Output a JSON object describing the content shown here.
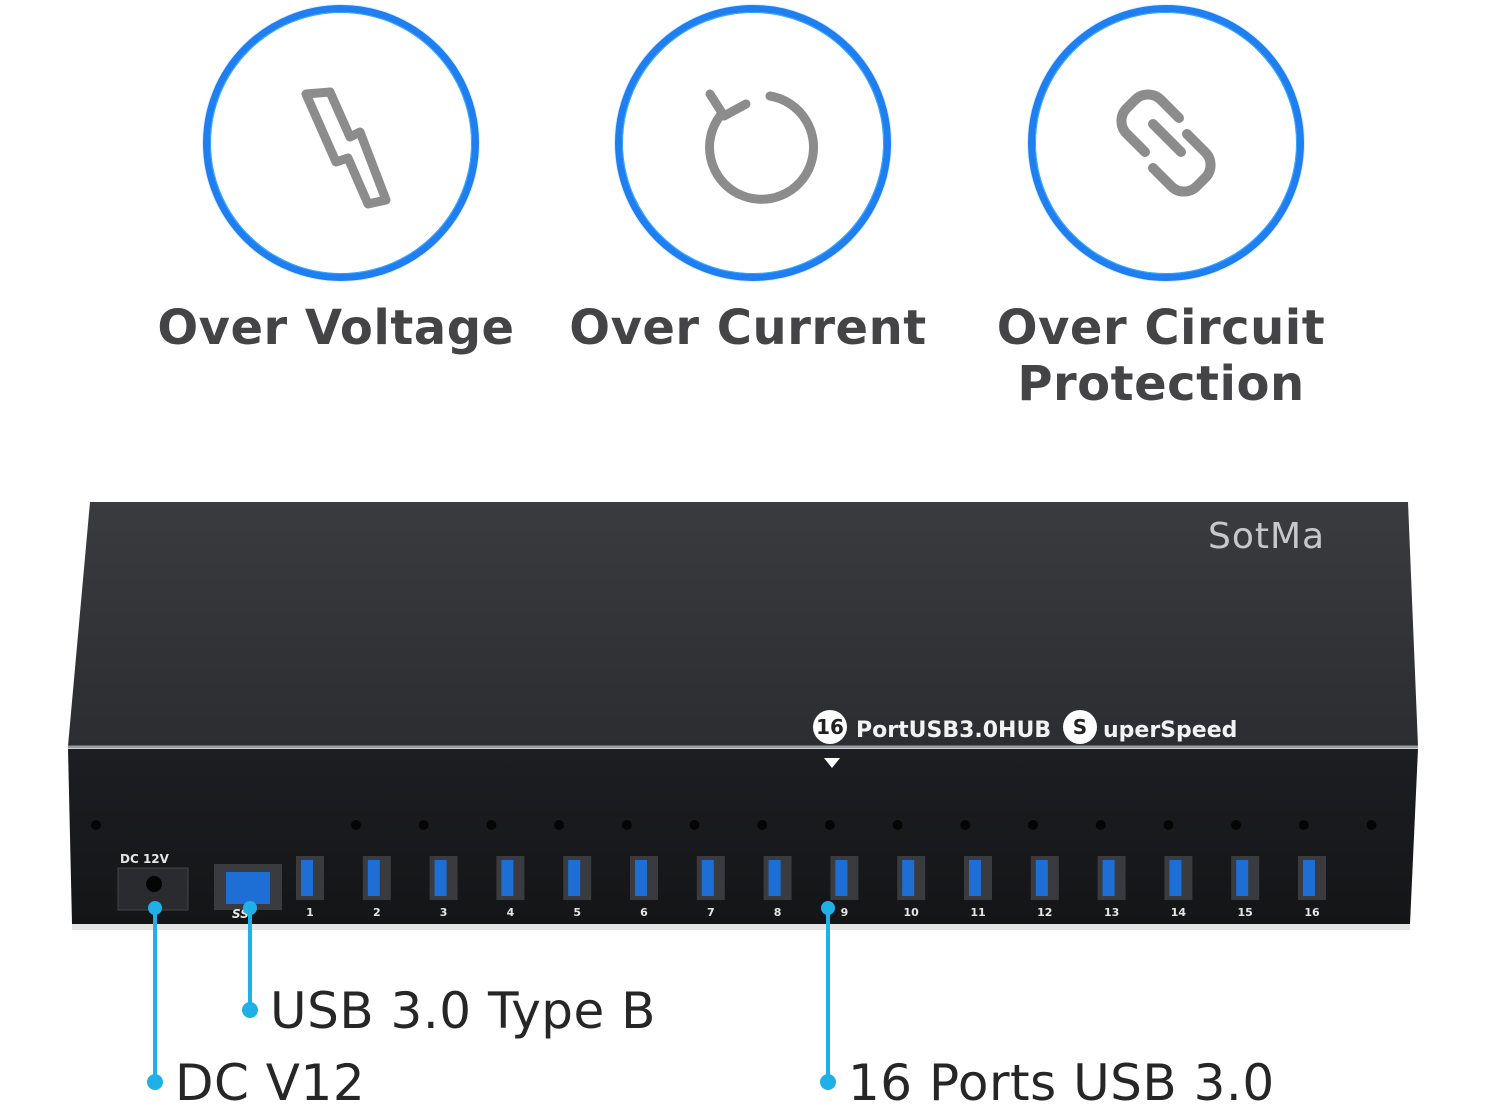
{
  "features": [
    {
      "icon": "lightning-icon",
      "label": "Over Voltage"
    },
    {
      "icon": "refresh-icon",
      "label": "Over Current"
    },
    {
      "icon": "link-icon",
      "label_line1": "Over Circuit",
      "label_line2": "Protection"
    }
  ],
  "device": {
    "brand": "SotMa",
    "badge_number": "16",
    "hub_label": "PortUSB3.0HUB",
    "badge_letter": "S",
    "speed_label": "uperSpeed",
    "dc_label": "DC 12V",
    "ss_label": "SS",
    "port_numbers": [
      "1",
      "2",
      "3",
      "4",
      "5",
      "6",
      "7",
      "8",
      "9",
      "10",
      "11",
      "12",
      "13",
      "14",
      "15",
      "16"
    ]
  },
  "callouts": {
    "usb_type_b": "USB 3.0 Type B",
    "dc": "DC V12",
    "ports": "16 Ports USB 3.0"
  },
  "colors": {
    "ring": "#1f7ff0",
    "icon": "#8c8c8c",
    "callout_line": "#1fb0e8",
    "device_body": "#2f3034",
    "usb_blue": "#1d6fd6"
  }
}
